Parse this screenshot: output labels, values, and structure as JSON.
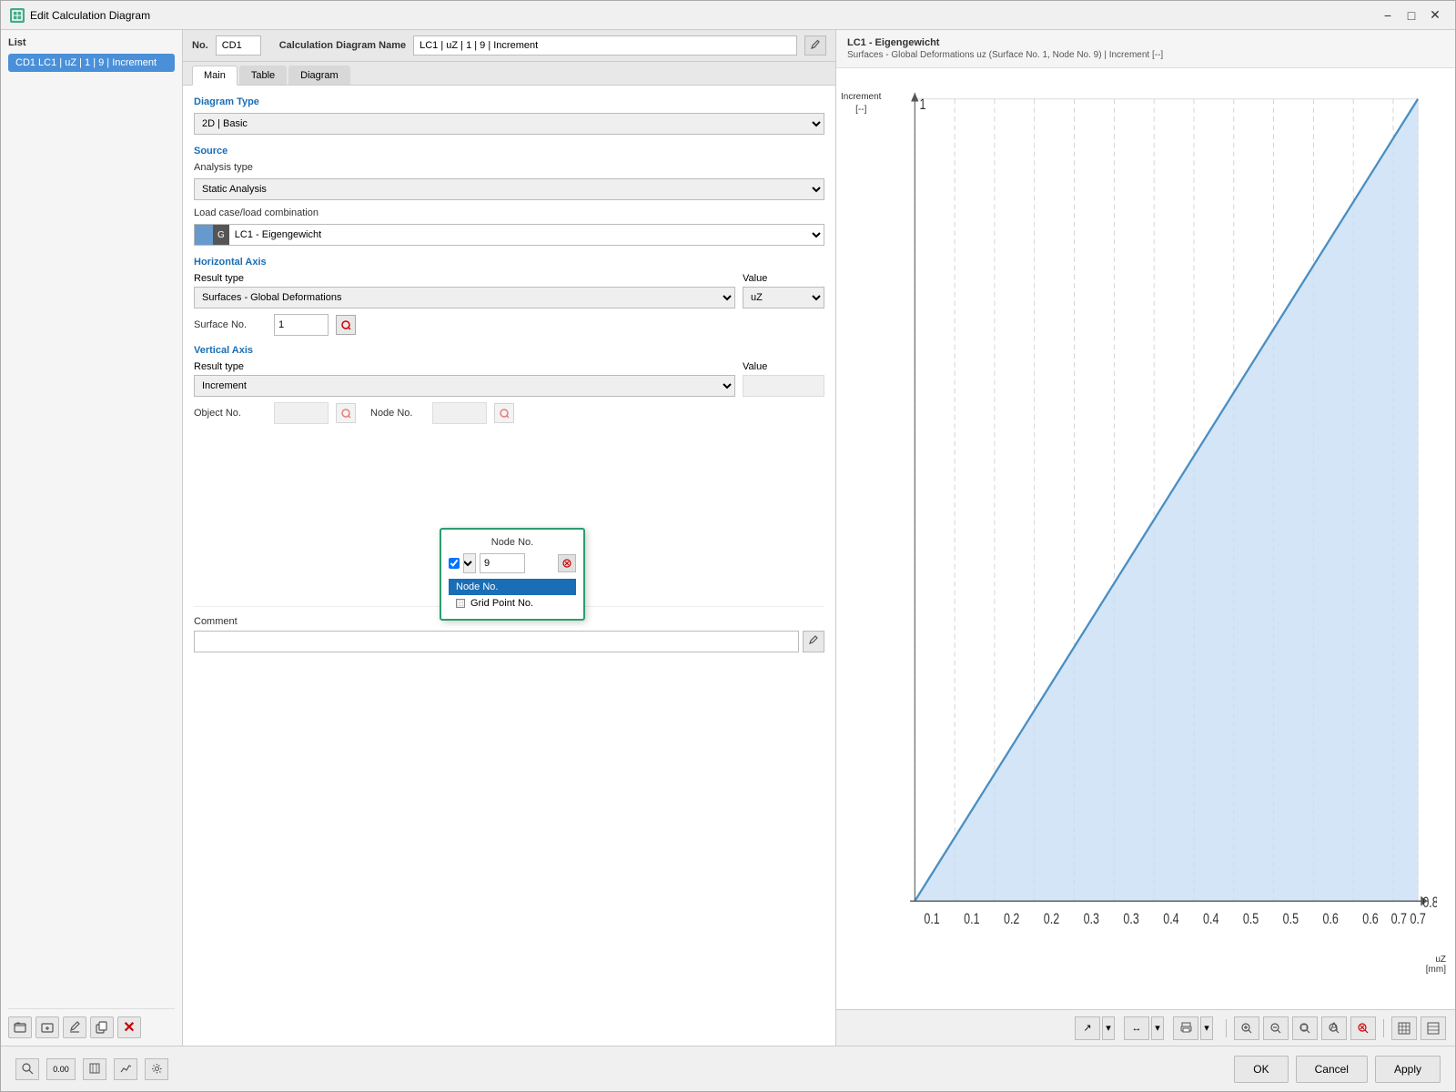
{
  "window": {
    "title": "Edit Calculation Diagram",
    "minimize_label": "−",
    "maximize_label": "□",
    "close_label": "✕"
  },
  "list_panel": {
    "header": "List",
    "active_item": "CD1  LC1 | uZ | 1 | 9 | Increment"
  },
  "info_bar": {
    "no_label": "No.",
    "no_value": "CD1",
    "name_label": "Calculation Diagram Name",
    "name_value": "LC1 | uZ | 1 | 9 | Increment"
  },
  "tabs": [
    {
      "label": "Main",
      "active": true
    },
    {
      "label": "Table",
      "active": false
    },
    {
      "label": "Diagram",
      "active": false
    }
  ],
  "form": {
    "diagram_type_label": "Diagram Type",
    "diagram_type_value": "2D | Basic",
    "source_header": "Source",
    "analysis_type_label": "Analysis type",
    "analysis_type_value": "Static Analysis",
    "load_case_label": "Load case/load combination",
    "load_case_value": "LC1 - Eigengewicht",
    "load_case_color": "#6699cc",
    "load_case_badge": "G",
    "horizontal_header": "Horizontal Axis",
    "result_type_label": "Result type",
    "result_type_value": "Surfaces - Global Deformations",
    "value_label": "Value",
    "value_value": "uZ",
    "surface_label": "Surface No.",
    "surface_value": "1",
    "node_popup": {
      "title": "Node No.",
      "value": "9",
      "menu_items": [
        "Node No.",
        "Grid Point No."
      ]
    },
    "vertical_header": "Vertical Axis",
    "v_result_type_label": "Result type",
    "v_result_type_value": "Increment",
    "v_value_label": "Value",
    "v_object_label": "Object No.",
    "v_node_label": "Node No.",
    "comment_header": "Comment",
    "comment_placeholder": ""
  },
  "diagram": {
    "title1": "LC1 - Eigengewicht",
    "title2": "Surfaces - Global Deformations uz (Surface No. 1, Node No. 9) | Increment [--]",
    "y_axis_label": "Increment\n[--]",
    "x_axis_label": "uZ\n[mm]",
    "y_values": [
      "1"
    ],
    "x_values": [
      "0.1",
      "0.1",
      "0.2",
      "0.2",
      "0.3",
      "0.3",
      "0.4",
      "0.4",
      "0.5",
      "0.5",
      "0.6",
      "0.6",
      "0.7",
      "0.7",
      "0.8"
    ]
  },
  "toolbar_buttons": {
    "cursor_label": "↗",
    "fit_h_label": "↔",
    "fit_v_label": "↕",
    "print_label": "🖨",
    "zoom_in_label": "+",
    "zoom_out_label": "−",
    "zoom_1_label": "1:1",
    "zoom_sel_label": "⊡",
    "zoom_reset_label": "✕",
    "view_table_label": "▦",
    "view_tree_label": "≡"
  },
  "footer": {
    "ok_label": "OK",
    "cancel_label": "Cancel",
    "apply_label": "Apply"
  }
}
